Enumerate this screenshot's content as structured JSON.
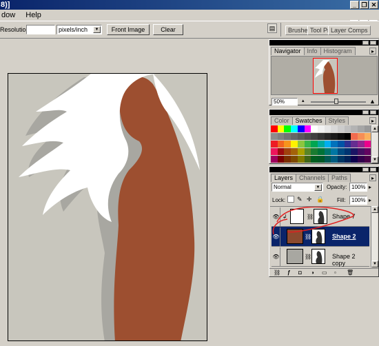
{
  "window": {
    "title": "8)]",
    "min_glyph": "_",
    "max_glyph": "❐",
    "close_glyph": "✕"
  },
  "menu": {
    "items": [
      "dow",
      "Help"
    ]
  },
  "options": {
    "resolution_label": "Resolution:",
    "resolution_value": "",
    "units_value": "pixels/inch",
    "front_image_label": "Front Image",
    "clear_label": "Clear",
    "well_tabs": [
      "Brushes",
      "Tool Pr",
      "Layer Comps"
    ]
  },
  "navigator": {
    "tabs": [
      "Navigator",
      "Info",
      "Histogram"
    ],
    "zoom_value": "50%"
  },
  "swatches": {
    "tabs": [
      "Color",
      "Swatches",
      "Styles"
    ],
    "colors": [
      [
        "#ff0000",
        "#ffff00",
        "#00ff00",
        "#00ffff",
        "#0000ff",
        "#ff00ff",
        "#ffffff",
        "#f2f2f2",
        "#e6e6e6",
        "#d9d9d9",
        "#cccccc",
        "#bfbfbf",
        "#b3b3b3",
        "#a6a6a6",
        "#999999"
      ],
      [
        "#8c8c8c",
        "#808080",
        "#737373",
        "#666666",
        "#595959",
        "#4d4d4d",
        "#404040",
        "#333333",
        "#262626",
        "#1a1a1a",
        "#0d0d0d",
        "#000000",
        "#f26c4f",
        "#f68e56",
        "#fbaf5d"
      ],
      [
        "#ed1c24",
        "#f26522",
        "#f7941d",
        "#fff200",
        "#8dc63f",
        "#39b54a",
        "#00a651",
        "#00a99d",
        "#00aeef",
        "#0072bc",
        "#0054a6",
        "#2e3192",
        "#662d91",
        "#92278f",
        "#ec008c"
      ],
      [
        "#ed145b",
        "#9e0b0f",
        "#a0410d",
        "#a36209",
        "#aba000",
        "#598527",
        "#197b30",
        "#007236",
        "#00746b",
        "#0076a3",
        "#004a80",
        "#003471",
        "#1b1464",
        "#440e62",
        "#630460"
      ],
      [
        "#9e005d",
        "#790000",
        "#7b2e00",
        "#7d4900",
        "#827b00",
        "#406618",
        "#005e20",
        "#005826",
        "#005952",
        "#005b7f",
        "#003663",
        "#002157",
        "#0d004c",
        "#32004b",
        "#4b0049"
      ]
    ]
  },
  "layers": {
    "tabs": [
      "Layers",
      "Channels",
      "Paths"
    ],
    "blend_mode": "Normal",
    "opacity_label": "Opacity:",
    "opacity_value": "100%",
    "lock_label": "Lock:",
    "fill_label": "Fill:",
    "fill_value": "100%",
    "items": [
      {
        "name": "Shape 7",
        "color": "#ffffff"
      },
      {
        "name": "Shape 2",
        "color": "#8b4a2f"
      },
      {
        "name": "Shape 2 copy",
        "color": "#a8a7a1"
      }
    ]
  },
  "canvas_colors": {
    "background": "#c8c6bd",
    "body": "#9d4f30",
    "shadow": "#a8a7a1",
    "hair": "#ffffff"
  }
}
